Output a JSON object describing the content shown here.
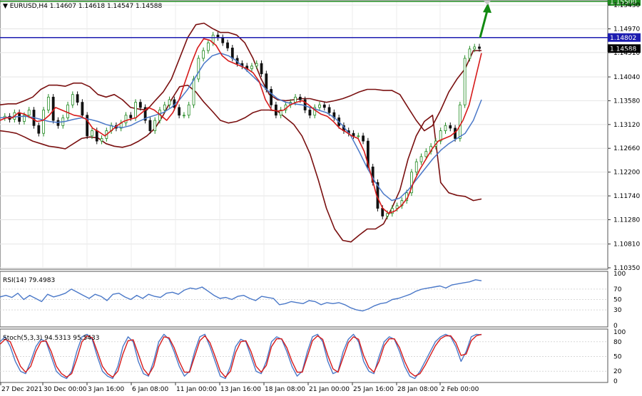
{
  "header": {
    "symbol": "EURUSD,H4",
    "prices": "1.14607 1.14618 1.14547 1.14588"
  },
  "colors": {
    "bollinger": "#7a1010",
    "ema_red": "#d61a1a",
    "ma_blue": "#4a78c8",
    "level_green": "#1f8a1f",
    "level_blue": "#1c1cb0",
    "arrow": "#128a12",
    "bull_candle": "#228b22",
    "bear_candle": "#111111",
    "rsi": "#4a78c8",
    "stoch_main": "#4a78c8",
    "stoch_signal": "#d61a1a"
  },
  "chart_data": [
    {
      "type": "line",
      "title": "EURUSD,H4",
      "subtitle": "1.14607 1.14618 1.14547 1.14588",
      "y_ticks": [
        "1.15430",
        "1.14970",
        "1.14510",
        "1.14040",
        "1.13580",
        "1.13120",
        "1.12660",
        "1.12200",
        "1.11740",
        "1.11280",
        "1.10810",
        "1.10350"
      ],
      "ylim": [
        1.1035,
        1.155
      ],
      "x_ticks": [
        "27 Dec 2021",
        "30 Dec 00:00",
        "3 Jan 16:00",
        "6 Jan 08:00",
        "11 Jan 00:00",
        "13 Jan 16:00",
        "18 Jan 08:00",
        "21 Jan 00:00",
        "25 Jan 16:00",
        "28 Jan 08:00",
        "2 Feb 00:00"
      ],
      "price_labels": [
        {
          "value": 1.155,
          "text": "1.15500",
          "style": "level_green"
        },
        {
          "value": 1.14802,
          "text": "1.14802",
          "style": "level_blue"
        },
        {
          "value": 1.14588,
          "text": "1.14588",
          "style": "current"
        }
      ],
      "levels": [
        1.155,
        1.14802
      ],
      "close_path": [
        1.1325,
        1.1328,
        1.1322,
        1.1335,
        1.1318,
        1.133,
        1.134,
        1.131,
        1.1295,
        1.134,
        1.1365,
        1.132,
        1.131,
        1.1325,
        1.135,
        1.137,
        1.1355,
        1.133,
        1.129,
        1.13,
        1.128,
        1.1285,
        1.13,
        1.131,
        1.1305,
        1.1315,
        1.133,
        1.1325,
        1.1355,
        1.1345,
        1.132,
        1.13,
        1.132,
        1.134,
        1.135,
        1.136,
        1.1345,
        1.133,
        1.133,
        1.135,
        1.14,
        1.144,
        1.1455,
        1.147,
        1.1485,
        1.148,
        1.147,
        1.146,
        1.144,
        1.143,
        1.1425,
        1.142,
        1.1425,
        1.143,
        1.141,
        1.138,
        1.135,
        1.133,
        1.134,
        1.135,
        1.1355,
        1.1365,
        1.136,
        1.134,
        1.133,
        1.1345,
        1.135,
        1.1345,
        1.1335,
        1.1325,
        1.131,
        1.13,
        1.1295,
        1.129,
        1.129,
        1.128,
        1.123,
        1.12,
        1.115,
        1.1135,
        1.114,
        1.115,
        1.1155,
        1.1165,
        1.118,
        1.122,
        1.124,
        1.125,
        1.126,
        1.127,
        1.128,
        1.13,
        1.131,
        1.1305,
        1.1285,
        1.135,
        1.144,
        1.1458,
        1.1462,
        1.1459
      ],
      "bollinger_upper": [
        1.135,
        1.1352,
        1.1352,
        1.1358,
        1.1365,
        1.138,
        1.1388,
        1.1388,
        1.1386,
        1.1392,
        1.1392,
        1.1385,
        1.137,
        1.1365,
        1.137,
        1.136,
        1.1345,
        1.1342,
        1.134,
        1.1358,
        1.1375,
        1.14,
        1.144,
        1.148,
        1.1505,
        1.1508,
        1.1498,
        1.149,
        1.149,
        1.1485,
        1.147,
        1.144,
        1.14,
        1.137,
        1.136,
        1.1358,
        1.136,
        1.1362,
        1.1362,
        1.1358,
        1.1355,
        1.1358,
        1.1362,
        1.1368,
        1.1375,
        1.138,
        1.138,
        1.1378,
        1.1378,
        1.137,
        1.1345,
        1.132,
        1.13,
        1.131,
        1.134,
        1.1375,
        1.14,
        1.142,
        1.1455,
        1.1455
      ],
      "bollinger_lower": [
        1.13,
        1.1298,
        1.1295,
        1.1288,
        1.128,
        1.1275,
        1.127,
        1.1268,
        1.1265,
        1.1275,
        1.1285,
        1.1288,
        1.1286,
        1.1275,
        1.127,
        1.1268,
        1.1272,
        1.128,
        1.129,
        1.1305,
        1.133,
        1.136,
        1.1385,
        1.1388,
        1.1375,
        1.1355,
        1.1338,
        1.132,
        1.1315,
        1.1318,
        1.1325,
        1.1335,
        1.134,
        1.134,
        1.1338,
        1.1325,
        1.1312,
        1.129,
        1.1255,
        1.1205,
        1.115,
        1.111,
        1.1088,
        1.1085,
        1.1098,
        1.111,
        1.111,
        1.112,
        1.115,
        1.1185,
        1.1245,
        1.129,
        1.1318,
        1.133,
        1.12,
        1.118,
        1.1175,
        1.1173,
        1.1165,
        1.1168
      ],
      "ema_red": [
        1.132,
        1.1325,
        1.1325,
        1.1335,
        1.1332,
        1.1325,
        1.1318,
        1.132,
        1.133,
        1.1345,
        1.134,
        1.1335,
        1.133,
        1.1328,
        1.1322,
        1.1305,
        1.1298,
        1.129,
        1.13,
        1.131,
        1.1318,
        1.1322,
        1.1325,
        1.1335,
        1.1345,
        1.134,
        1.133,
        1.132,
        1.1335,
        1.136,
        1.1395,
        1.143,
        1.146,
        1.1478,
        1.1475,
        1.1465,
        1.1445,
        1.1435,
        1.143,
        1.1425,
        1.142,
        1.1412,
        1.1395,
        1.136,
        1.134,
        1.1338,
        1.134,
        1.135,
        1.1355,
        1.1358,
        1.135,
        1.134,
        1.1332,
        1.1328,
        1.1318,
        1.1305,
        1.1298,
        1.129,
        1.1285,
        1.126,
        1.122,
        1.1175,
        1.115,
        1.114,
        1.1145,
        1.1155,
        1.117,
        1.12,
        1.1225,
        1.1245,
        1.1265,
        1.128,
        1.1285,
        1.129,
        1.13,
        1.132,
        1.135,
        1.14,
        1.145
      ],
      "ma_blue": [
        1.1325,
        1.1326,
        1.1327,
        1.1328,
        1.1326,
        1.1322,
        1.1318,
        1.1316,
        1.1318,
        1.1322,
        1.1325,
        1.1322,
        1.1318,
        1.1312,
        1.1308,
        1.1306,
        1.131,
        1.1318,
        1.1325,
        1.133,
        1.1335,
        1.1345,
        1.136,
        1.138,
        1.1405,
        1.143,
        1.1445,
        1.145,
        1.1445,
        1.1435,
        1.142,
        1.1405,
        1.139,
        1.1375,
        1.1362,
        1.1355,
        1.1352,
        1.135,
        1.1345,
        1.134,
        1.1335,
        1.1325,
        1.131,
        1.129,
        1.126,
        1.1228,
        1.12,
        1.1178,
        1.1165,
        1.117,
        1.1185,
        1.1205,
        1.1225,
        1.1245,
        1.1262,
        1.1275,
        1.1285,
        1.1295,
        1.132,
        1.136
      ],
      "arrow": {
        "from": [
          1.148,
          74
        ],
        "to": [
          1.1543,
          81
        ],
        "color": "level_green"
      }
    },
    {
      "type": "line",
      "title": "RSI(14) 79.4983",
      "ylim": [
        0,
        100
      ],
      "y_ticks": [
        "100",
        "70",
        "50",
        "30",
        "0"
      ],
      "levels": [
        70,
        50,
        30
      ],
      "values": [
        55,
        58,
        54,
        62,
        50,
        58,
        52,
        46,
        60,
        55,
        58,
        62,
        70,
        64,
        58,
        52,
        60,
        56,
        48,
        60,
        62,
        55,
        50,
        58,
        52,
        60,
        56,
        54,
        62,
        64,
        60,
        68,
        72,
        70,
        74,
        66,
        58,
        52,
        54,
        50,
        56,
        58,
        52,
        48,
        56,
        54,
        52,
        40,
        42,
        46,
        44,
        42,
        48,
        46,
        40,
        44,
        42,
        44,
        40,
        34,
        30,
        28,
        32,
        38,
        42,
        44,
        50,
        52,
        56,
        60,
        66,
        70,
        72,
        74,
        76,
        72,
        78,
        80,
        82,
        84,
        88,
        86
      ]
    },
    {
      "type": "line",
      "title": "Stoch(5,3,3) 94.5313 95.5433",
      "ylim": [
        0,
        100
      ],
      "y_ticks": [
        "100",
        "80",
        "50",
        "20",
        "0"
      ],
      "levels": [
        80,
        50,
        20
      ],
      "series": [
        {
          "values": [
            80,
            90,
            70,
            40,
            20,
            15,
            40,
            70,
            85,
            80,
            50,
            20,
            10,
            5,
            20,
            60,
            90,
            95,
            85,
            50,
            20,
            10,
            5,
            30,
            70,
            90,
            80,
            40,
            15,
            10,
            40,
            80,
            95,
            85,
            60,
            30,
            10,
            20,
            60,
            90,
            95,
            70,
            40,
            10,
            5,
            30,
            70,
            85,
            80,
            50,
            20,
            15,
            40,
            80,
            90,
            85,
            60,
            30,
            10,
            20,
            60,
            90,
            95,
            80,
            40,
            15,
            20,
            60,
            85,
            95,
            80,
            40,
            20,
            15,
            50,
            80,
            90,
            85,
            60,
            30,
            10,
            5,
            20,
            40,
            60,
            80,
            90,
            95,
            90,
            70,
            40,
            60,
            90,
            95,
            94
          ]
        },
        {
          "values": [
            75,
            85,
            80,
            55,
            30,
            18,
            30,
            60,
            80,
            82,
            60,
            30,
            15,
            8,
            15,
            45,
            80,
            92,
            88,
            60,
            30,
            15,
            8,
            20,
            55,
            82,
            84,
            55,
            25,
            12,
            30,
            70,
            90,
            88,
            68,
            40,
            18,
            18,
            50,
            82,
            92,
            78,
            50,
            20,
            8,
            20,
            58,
            80,
            82,
            60,
            30,
            18,
            32,
            70,
            86,
            86,
            68,
            40,
            18,
            18,
            50,
            82,
            92,
            85,
            52,
            25,
            18,
            48,
            78,
            90,
            85,
            52,
            28,
            18,
            40,
            72,
            86,
            86,
            68,
            40,
            18,
            10,
            15,
            32,
            52,
            72,
            86,
            92,
            92,
            78,
            52,
            55,
            82,
            92,
            95
          ]
        }
      ]
    }
  ]
}
